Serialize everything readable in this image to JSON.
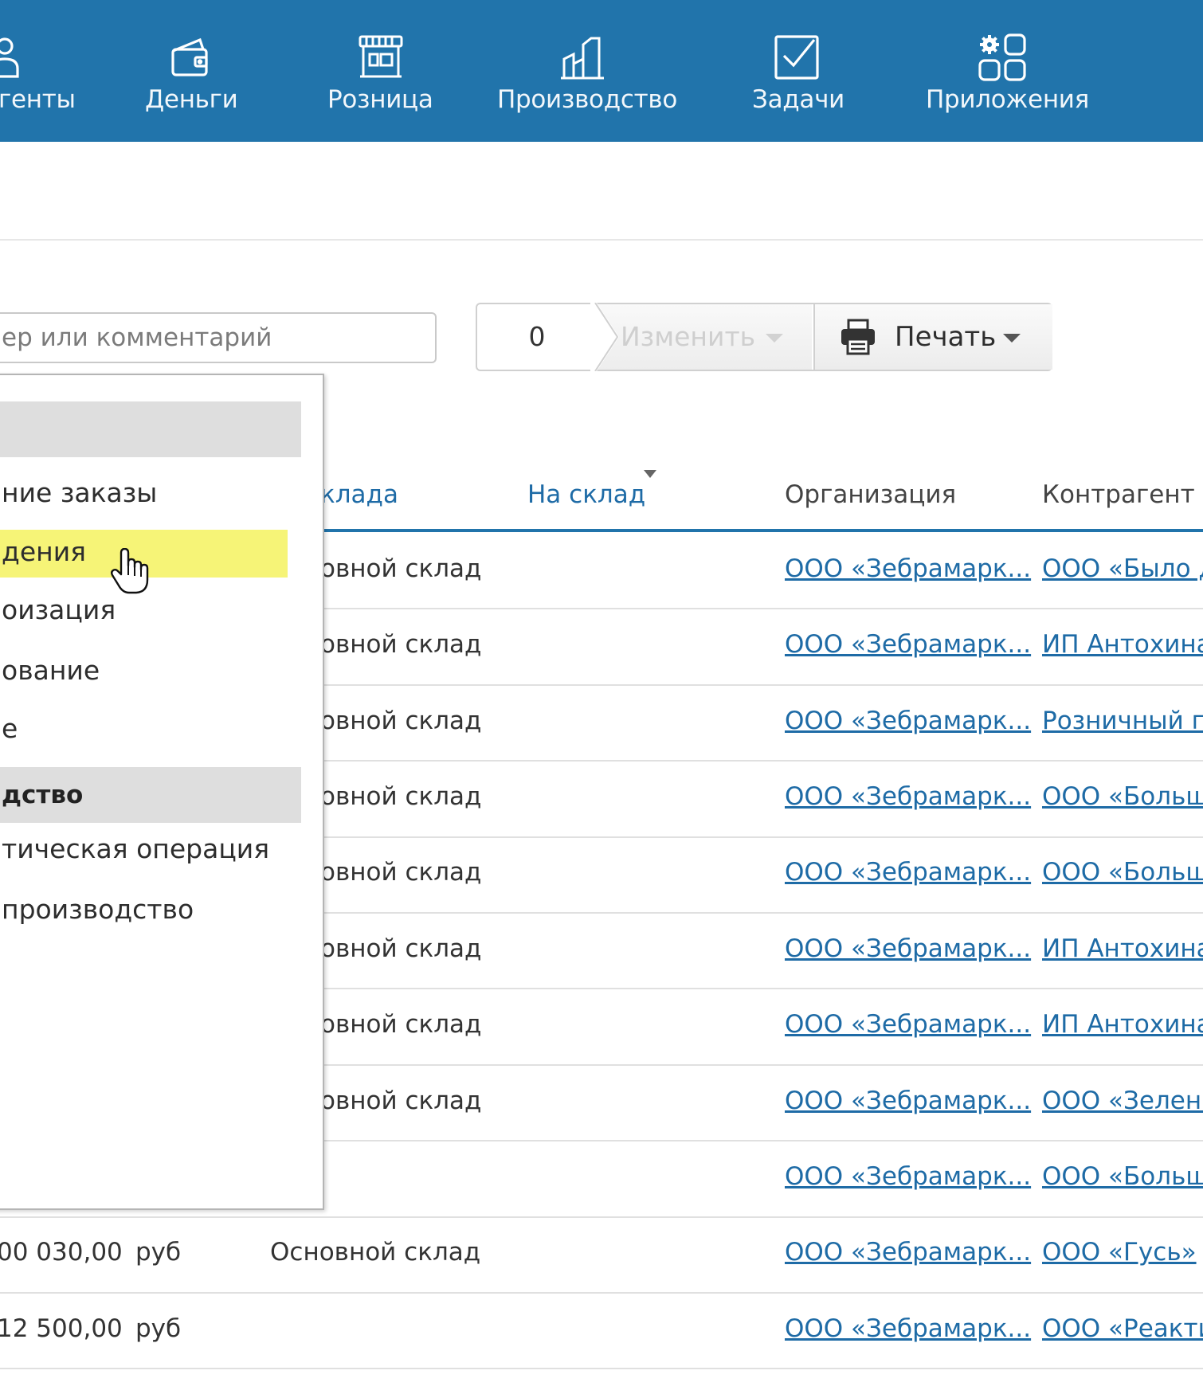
{
  "topnav": {
    "items": [
      {
        "label": "генты",
        "icon": "contacts-icon"
      },
      {
        "label": "Деньги",
        "icon": "wallet-icon"
      },
      {
        "label": "Розница",
        "icon": "store-icon"
      },
      {
        "label": "Производство",
        "icon": "factory-icon"
      },
      {
        "label": "Задачи",
        "icon": "task-check-icon"
      },
      {
        "label": "Приложения",
        "icon": "apps-grid-icon"
      }
    ]
  },
  "search": {
    "placeholder": "ер или комментарий"
  },
  "toolbar": {
    "selected_count": "0",
    "edit_label": "Изменить",
    "print_label": "Печать"
  },
  "table": {
    "headers": {
      "from_warehouse": "клада",
      "to_warehouse": "На склад",
      "organization": "Организация",
      "counterparty": "Контрагент"
    },
    "rows": [
      {
        "sum": "",
        "currency": "",
        "warehouse": "овной склад",
        "organization": "ООО «Зебрамарк...",
        "counterparty": "ООО «Было д"
      },
      {
        "sum": "",
        "currency": "",
        "warehouse": "овной склад",
        "organization": "ООО «Зебрамарк...",
        "counterparty": "ИП Антохина"
      },
      {
        "sum": "",
        "currency": "",
        "warehouse": "овной склад",
        "organization": "ООО «Зебрамарк...",
        "counterparty": "Розничный п"
      },
      {
        "sum": "",
        "currency": "",
        "warehouse": "овной склад",
        "organization": "ООО «Зебрамарк...",
        "counterparty": "ООО «Больш"
      },
      {
        "sum": "",
        "currency": "",
        "warehouse": "овной склад",
        "organization": "ООО «Зебрамарк...",
        "counterparty": "ООО «Больш"
      },
      {
        "sum": "",
        "currency": "",
        "warehouse": "овной склад",
        "organization": "ООО «Зебрамарк...",
        "counterparty": "ИП Антохина"
      },
      {
        "sum": "",
        "currency": "",
        "warehouse": "овной склад",
        "organization": "ООО «Зебрамарк...",
        "counterparty": "ИП Антохина"
      },
      {
        "sum": "",
        "currency": "",
        "warehouse": "овной склад",
        "organization": "ООО «Зебрамарк...",
        "counterparty": "ООО «Зелень"
      },
      {
        "sum": "",
        "currency": "",
        "warehouse": "",
        "organization": "ООО «Зебрамарк...",
        "counterparty": "ООО «Больш"
      },
      {
        "sum": "00 030,00",
        "currency": "руб",
        "warehouse": "Основной склад",
        "organization": "ООО «Зебрамарк...",
        "counterparty": "ООО «Гусь»"
      },
      {
        "sum": "12 500,00",
        "currency": "руб",
        "warehouse": "",
        "organization": "ООО «Зебрамарк...",
        "counterparty": "ООО «Реакти"
      }
    ]
  },
  "dropdown": {
    "items": [
      {
        "label": "",
        "type": "group"
      },
      {
        "label": "ние заказы",
        "type": "item"
      },
      {
        "label": "дения",
        "type": "item",
        "highlighted": true
      },
      {
        "label": "оизация",
        "type": "item"
      },
      {
        "label": "ование",
        "type": "item"
      },
      {
        "label": "е",
        "type": "item"
      },
      {
        "label": "дство",
        "type": "group"
      },
      {
        "label": "тическая операция",
        "type": "item"
      },
      {
        "label": " производство",
        "type": "item"
      }
    ]
  },
  "colors": {
    "nav_bg": "#2174ab",
    "link": "#1e6ba6",
    "highlight": "#f6f477"
  }
}
